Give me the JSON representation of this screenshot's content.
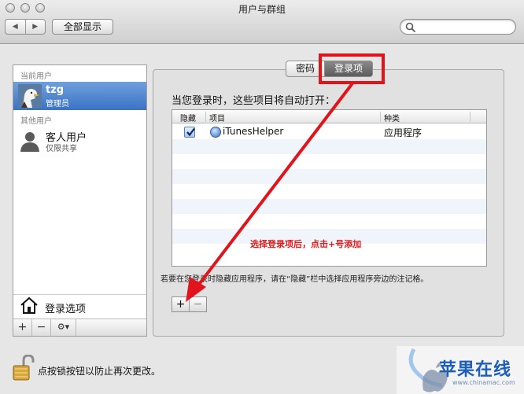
{
  "window": {
    "title": "用户与群组"
  },
  "toolbar": {
    "back_glyph": "◀",
    "forward_glyph": "▶",
    "show_all_label": "全部显示",
    "search_placeholder": ""
  },
  "sidebar": {
    "current_users_header": "当前用户",
    "current_user": {
      "name": "tzg",
      "role": "管理员"
    },
    "other_users_header": "其他用户",
    "guest_user": {
      "name": "客人用户",
      "role": "仅限共享"
    },
    "login_options_label": "登录选项",
    "add_glyph": "+",
    "remove_glyph": "−",
    "action_glyph": "⚙▾"
  },
  "tabs": [
    {
      "label": "密码",
      "active": false
    },
    {
      "label": "登录项",
      "active": true
    }
  ],
  "login_items": {
    "intro_text": "当您登录时，这些项目将自动打开：",
    "columns": {
      "hide": "隐藏",
      "item": "项目",
      "kind": "种类"
    },
    "rows": [
      {
        "hidden": true,
        "name": "iTunesHelper",
        "kind": "应用程序"
      }
    ],
    "hint_text": "若要在您登录时隐藏应用程序，请在“隐藏”栏中选择应用程序旁边的注记格。",
    "add_glyph": "+",
    "remove_glyph": "−"
  },
  "lock": {
    "text": "点按锁按钮以防止再次更改。"
  },
  "annotation": {
    "text": "选择登录项后，点击+号添加",
    "color": "#e1141b"
  },
  "watermark": {
    "brand": "苹果在线",
    "url": "www.chinamac.com"
  },
  "colors": {
    "selection": "#3b73c4",
    "annotation_red": "#e1141b"
  }
}
